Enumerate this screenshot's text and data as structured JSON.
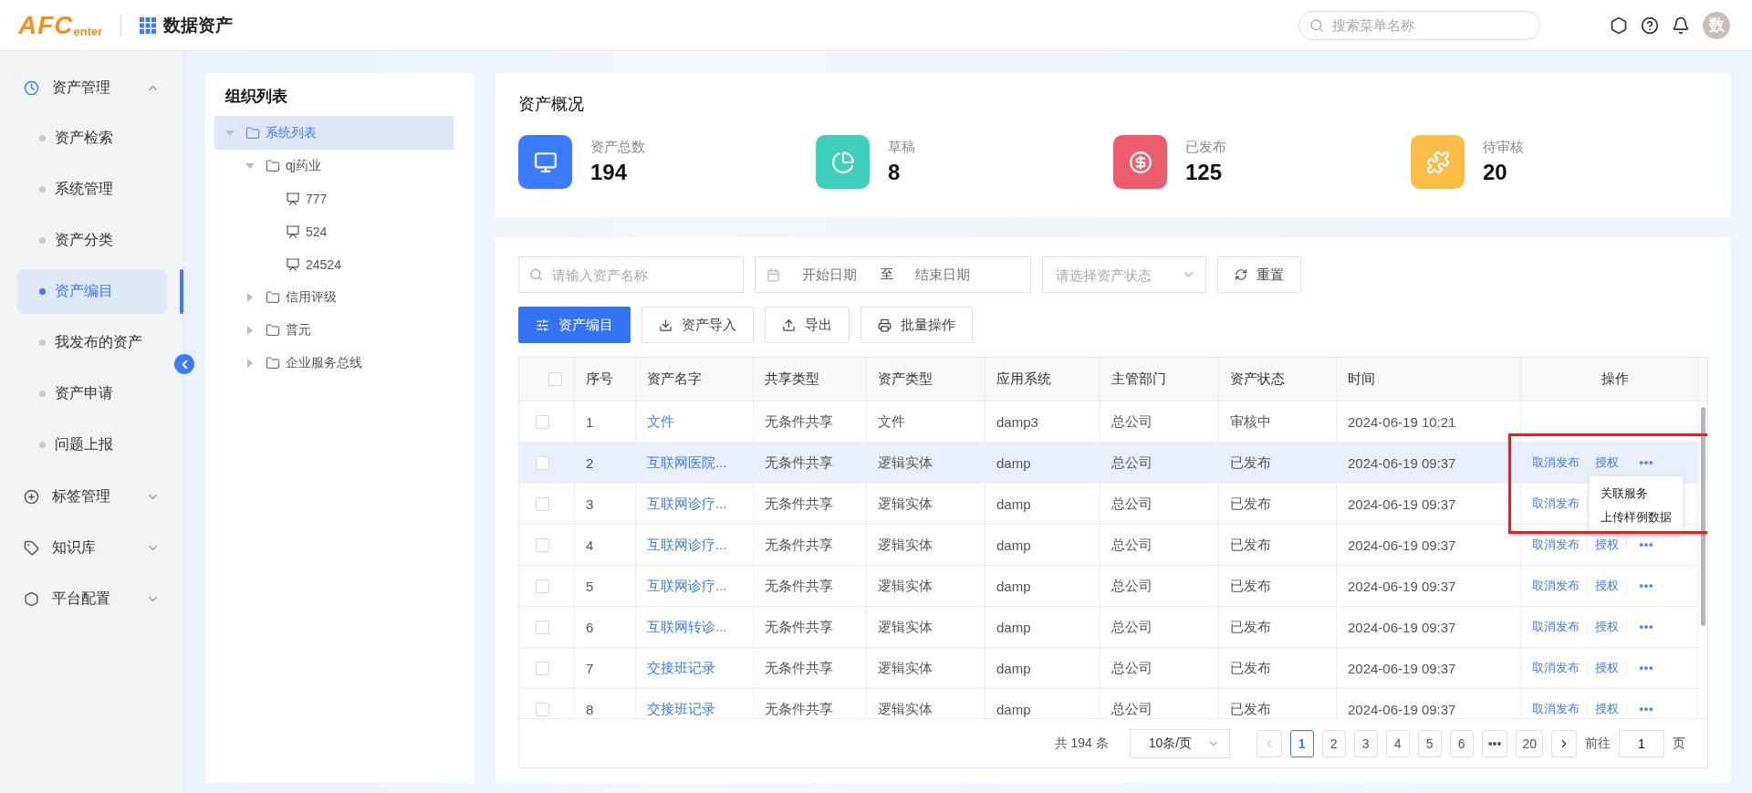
{
  "header": {
    "logo": {
      "text": "AFC",
      "suffix": "enter"
    },
    "app_title": "数据资产",
    "search": {
      "placeholder": "搜索菜单名称"
    },
    "avatar": "数"
  },
  "sidebar": {
    "groups": [
      {
        "label": "资产管理",
        "expanded": true,
        "children": [
          {
            "label": "资产检索",
            "selected": false
          },
          {
            "label": "系统管理",
            "selected": false
          },
          {
            "label": "资产分类",
            "selected": false
          },
          {
            "label": "资产编目",
            "selected": true
          },
          {
            "label": "我发布的资产",
            "selected": false
          },
          {
            "label": "资产申请",
            "selected": false
          },
          {
            "label": "问题上报",
            "selected": false
          }
        ]
      },
      {
        "label": "标签管理",
        "expanded": false
      },
      {
        "label": "知识库",
        "expanded": false
      },
      {
        "label": "平台配置",
        "expanded": false
      }
    ]
  },
  "tree": {
    "title": "组织列表",
    "nodes": [
      {
        "label": "系统列表",
        "kind": "folder",
        "expanded": true,
        "selected": true,
        "children": [
          {
            "label": "qj药业",
            "kind": "folder",
            "expanded": true,
            "selected": false,
            "children": [
              {
                "label": "777",
                "kind": "system",
                "selected": false
              },
              {
                "label": "524",
                "kind": "system",
                "selected": false
              },
              {
                "label": "24524",
                "kind": "system",
                "selected": false
              }
            ]
          },
          {
            "label": "信用评级",
            "kind": "folder",
            "expanded": false,
            "selected": false
          },
          {
            "label": "普元",
            "kind": "folder",
            "expanded": false,
            "selected": false
          },
          {
            "label": "企业服务总线",
            "kind": "folder",
            "expanded": false,
            "selected": false
          }
        ]
      }
    ]
  },
  "overview": {
    "title": "资产概况",
    "stats": [
      {
        "kind": "total",
        "label": "资产总数",
        "value": "194",
        "color": "#3b7cff"
      },
      {
        "kind": "draft",
        "label": "草稿",
        "value": "8",
        "color": "#3fcfbd"
      },
      {
        "kind": "published",
        "label": "已发布",
        "value": "125",
        "color": "#ee5d6c"
      },
      {
        "kind": "pending",
        "label": "待审核",
        "value": "20",
        "color": "#fbbd46"
      }
    ]
  },
  "filters": {
    "search": {
      "placeholder": "请输入资产名称"
    },
    "date_range": {
      "start_placeholder": "开始日期",
      "separator": "至",
      "end_placeholder": "结束日期"
    },
    "status": {
      "placeholder": "请选择资产状态"
    },
    "reset": "重置"
  },
  "actions": [
    {
      "kind": "primary",
      "label": "资产编目"
    },
    {
      "kind": "import",
      "label": "资产导入"
    },
    {
      "kind": "export",
      "label": "导出"
    },
    {
      "kind": "batch",
      "label": "批量操作"
    }
  ],
  "table": {
    "columns": [
      "序号",
      "资产名字",
      "共享类型",
      "资产类型",
      "应用系统",
      "主管部门",
      "资产状态",
      "时间",
      "操作"
    ],
    "header_checked": false,
    "rows": [
      {
        "checked": false,
        "selected": false,
        "cells": [
          "1",
          "文件",
          "无条件共享",
          "文件",
          "damp3",
          "总公司",
          "审核中",
          "2024-06-19 10:21"
        ],
        "actions": [],
        "more": false
      },
      {
        "checked": false,
        "selected": true,
        "cells": [
          "2",
          "互联网医院...",
          "无条件共享",
          "逻辑实体",
          "damp",
          "总公司",
          "已发布",
          "2024-06-19 09:37"
        ],
        "actions": [
          "取消发布",
          "授权"
        ],
        "more": true,
        "menu": [
          "关联服务",
          "上传样例数据"
        ],
        "marked": true
      },
      {
        "checked": false,
        "selected": false,
        "cells": [
          "3",
          "互联网诊疗...",
          "无条件共享",
          "逻辑实体",
          "damp",
          "总公司",
          "已发布",
          "2024-06-19 09:37"
        ],
        "actions": [
          "取消发布"
        ],
        "more": false
      },
      {
        "checked": false,
        "selected": false,
        "cells": [
          "4",
          "互联网诊疗...",
          "无条件共享",
          "逻辑实体",
          "damp",
          "总公司",
          "已发布",
          "2024-06-19 09:37"
        ],
        "actions": [
          "取消发布",
          "授权"
        ],
        "more": true
      },
      {
        "checked": false,
        "selected": false,
        "cells": [
          "5",
          "互联网诊疗...",
          "无条件共享",
          "逻辑实体",
          "damp",
          "总公司",
          "已发布",
          "2024-06-19 09:37"
        ],
        "actions": [
          "取消发布",
          "授权"
        ],
        "more": true
      },
      {
        "checked": false,
        "selected": false,
        "cells": [
          "6",
          "互联网转诊...",
          "无条件共享",
          "逻辑实体",
          "damp",
          "总公司",
          "已发布",
          "2024-06-19 09:37"
        ],
        "actions": [
          "取消发布",
          "授权"
        ],
        "more": true
      },
      {
        "checked": false,
        "selected": false,
        "cells": [
          "7",
          "交接班记录",
          "无条件共享",
          "逻辑实体",
          "damp",
          "总公司",
          "已发布",
          "2024-06-19 09:37"
        ],
        "actions": [
          "取消发布",
          "授权"
        ],
        "more": true
      },
      {
        "checked": false,
        "selected": false,
        "cells": [
          "8",
          "交接班记录",
          "无条件共享",
          "逻辑实体",
          "damp",
          "总公司",
          "已发布",
          "2024-06-19 09:37"
        ],
        "actions": [
          "取消发布",
          "授权"
        ],
        "more": true
      }
    ]
  },
  "pagination": {
    "total": "共 194 条",
    "page_size": "10条/页",
    "pages": [
      {
        "label": "1",
        "selected": true
      },
      {
        "label": "2",
        "selected": false
      },
      {
        "label": "3",
        "selected": false
      },
      {
        "label": "4",
        "selected": false
      },
      {
        "label": "5",
        "selected": false
      },
      {
        "label": "6",
        "selected": false
      },
      {
        "label": "•••",
        "selected": false
      },
      {
        "label": "20",
        "selected": false
      }
    ],
    "goto_label": "前往",
    "goto_value": "1",
    "goto_unit": "页"
  }
}
